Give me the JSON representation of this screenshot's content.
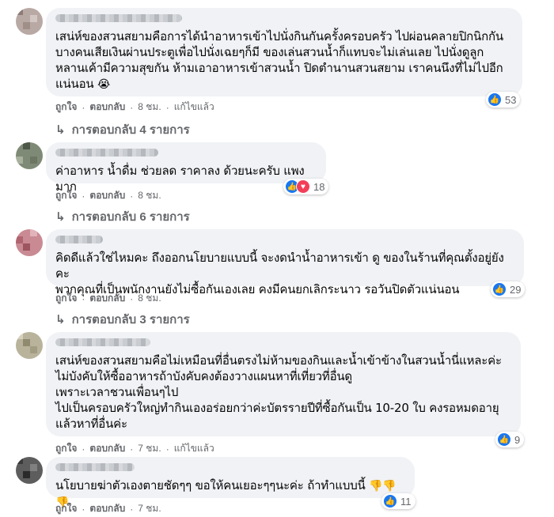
{
  "comments": [
    {
      "text": "เสน่ห์ของสวนสยามคือการได้นำอาหารเข้าไปนั่งกินกันครั้งครอบครัว ไปผ่อนคลายปิกนิกกัน\nบางคนเสียเงินผ่านประตูเพื่อไปนั่งเฉยๆก็มี ของเล่นสวนน้ำก็แทบจะไม่เล่นเลย ไปนั่งดูลูก\nหลานเค้ามีความสุขกัน ห้ามเอาอาหารเข้าสวนน้ำ ปิดตำนานสวนสยาม เราคนนึงที่ไม่ไปอีก\nแน่นอน",
      "emoji": "😭",
      "reaction_count": "53",
      "reaction_icons": [
        "like-icon"
      ],
      "actions": {
        "like": "ถูกใจ",
        "reply": "ตอบกลับ",
        "time": "8 ชม.",
        "edited": "แก้ไขแล้ว"
      },
      "replies_label": "การตอบกลับ 4 รายการ"
    },
    {
      "text": "ค่าอาหาร น้ำดื่ม ช่วยลด ราคาลง ด้วยนะครับ แพงมาก",
      "reaction_count": "18",
      "reaction_icons": [
        "like-icon",
        "love-icon"
      ],
      "actions": {
        "like": "ถูกใจ",
        "reply": "ตอบกลับ",
        "time": "8 ชม."
      },
      "replies_label": "การตอบกลับ 6 รายการ"
    },
    {
      "text": "คิดดีแล้วใช่ไหมคะ ถึงออกนโยบายแบบนี้ จะงดนำน้ำอาหารเข้า ดู ของในร้านที่คุณตั้งอยู่ยังคะ\nพวกคุณที่เป็นพนักงานยังไม่ซื้อกันเองเลย คงมีคนยกเลิกระนาว รอวันปิดตัวแน่นอน",
      "reaction_count": "29",
      "reaction_icons": [
        "like-icon"
      ],
      "actions": {
        "like": "ถูกใจ",
        "reply": "ตอบกลับ",
        "time": "8 ชม."
      },
      "replies_label": "การตอบกลับ 3 รายการ"
    },
    {
      "text": "เสน่ห์ของสวนสยามคือไม่เหมือนที่อื่นตรงไม่ห้ามของกินและน้ำเข้าข้างในสวนน้ำนี่แหละค่ะ\nไม่บังคับให้ซื้ออาหารถ้าบังคับคงต้องวางแผนหาที่เที่ยวที่อื่นดู\nเพราะเวลาชวนเพื่อนๆไป\nไปเป็นครอบครัวใหญ่ทำกินเองอร่อยกว่าค่ะบัตรรายปีที่ซื้อกันเป็น 10-20 ใบ คงรอหมดอายุ\nแล้วหาที่อื่นค่ะ",
      "reaction_count": "9",
      "reaction_icons": [
        "like-icon"
      ],
      "actions": {
        "like": "ถูกใจ",
        "reply": "ตอบกลับ",
        "time": "7 ชม.",
        "edited": "แก้ไขแล้ว"
      }
    },
    {
      "text": "นโยบายฆ่าตัวเองตายชัดๆๆ ขอให้คนเยอะๆๆนะค่ะ ถ้าทำแบบนี้",
      "emoji": "👎👎👎",
      "reaction_count": "11",
      "reaction_icons": [
        "like-icon"
      ],
      "actions": {
        "like": "ถูกใจ",
        "reply": "ตอบกลับ",
        "time": "7 ชม."
      }
    }
  ],
  "colors": {
    "bubble": "#f0f2f5",
    "like_blue": "#1877f2",
    "love_red": "#f33e58",
    "meta_gray": "#65676b"
  }
}
